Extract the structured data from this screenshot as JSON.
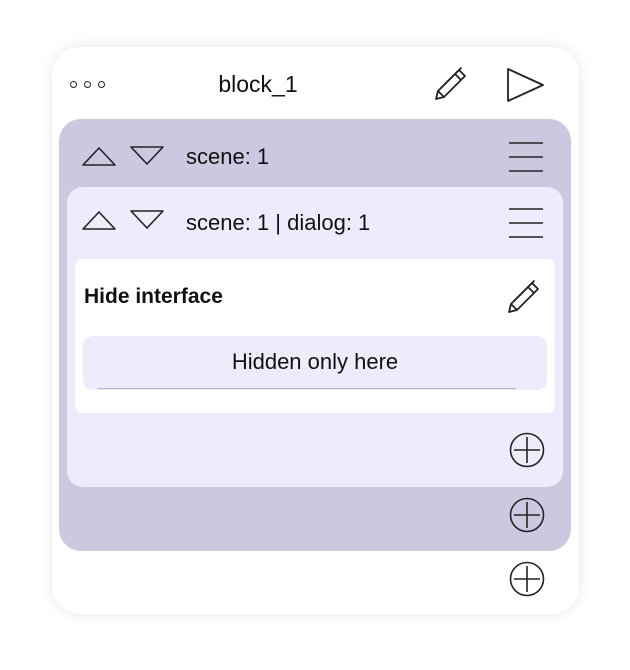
{
  "block": {
    "title": "block_1"
  },
  "scene": {
    "label": "scene: 1"
  },
  "dialog": {
    "label": "scene: 1 | dialog: 1"
  },
  "action": {
    "title": "Hide interface",
    "option": "Hidden only here"
  },
  "colors": {
    "scene_bg": "#cdc8e0",
    "dialog_bg": "#edecfc",
    "card_bg": "#ffffff"
  },
  "icons": [
    "more-dots-icon",
    "pencil-icon",
    "play-icon",
    "arrow-up-icon",
    "arrow-down-icon",
    "menu-icon",
    "plus-circle-icon"
  ]
}
